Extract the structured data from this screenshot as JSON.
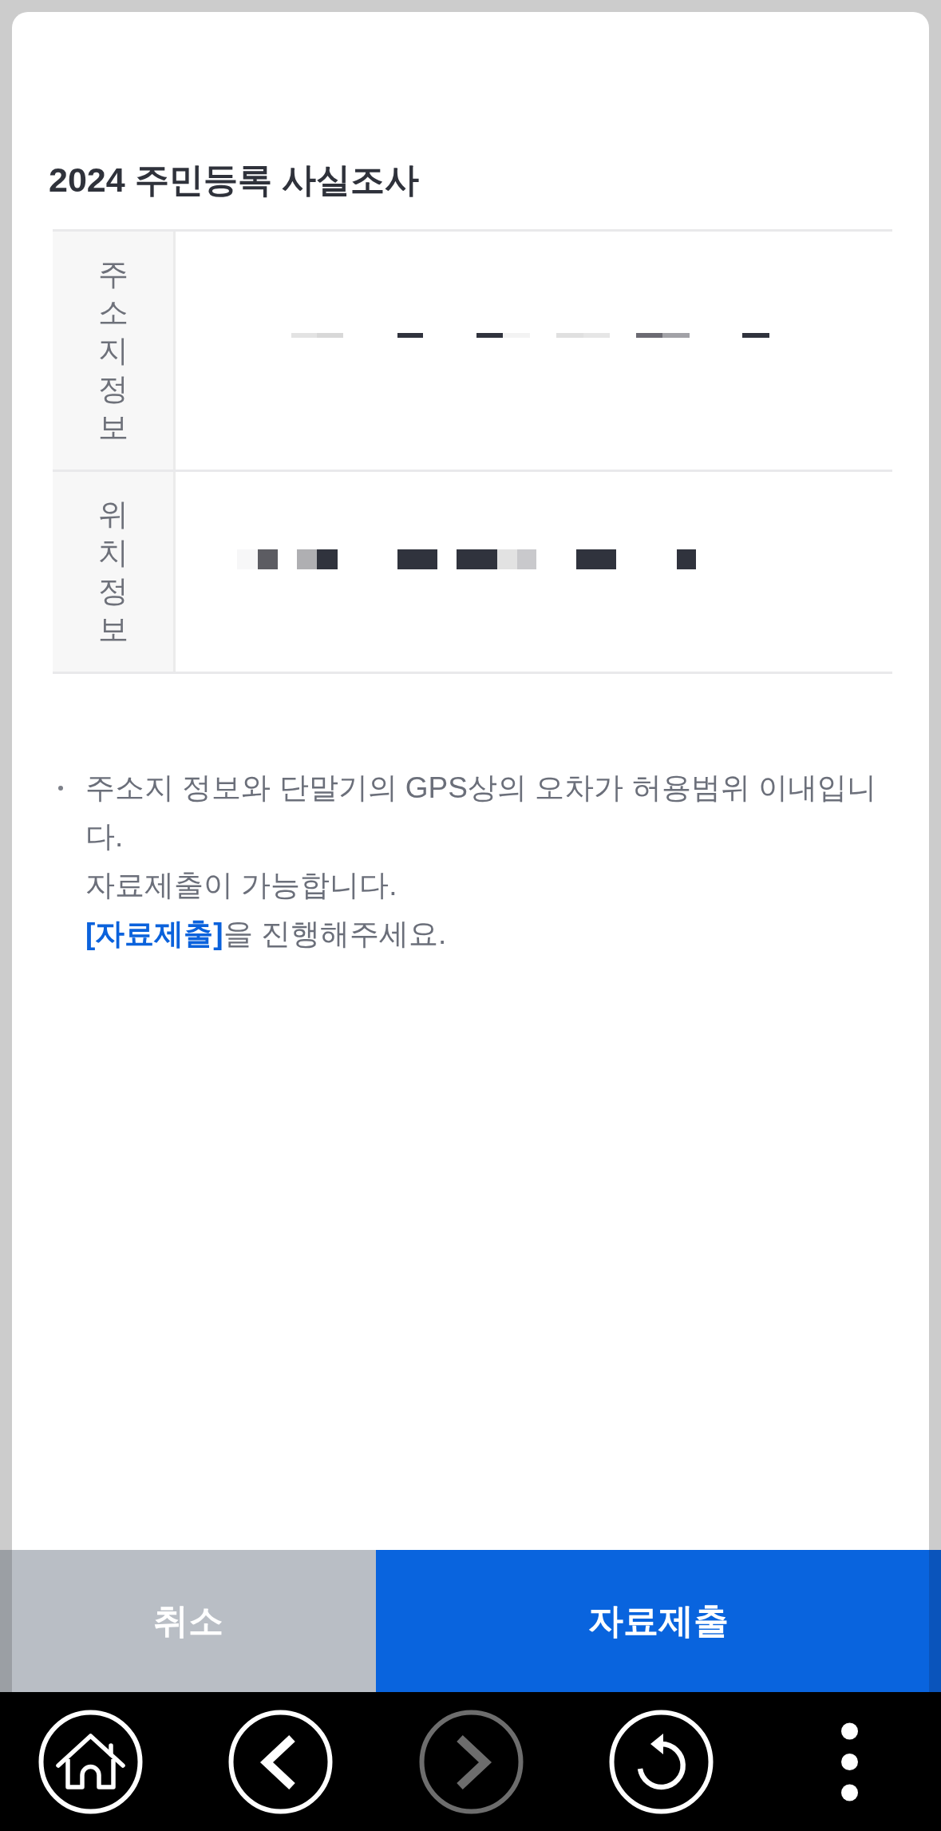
{
  "title": "2024 주민등록 사실조사",
  "info_table": {
    "rows": [
      {
        "label": "주소지정보"
      },
      {
        "label": "위치정보"
      }
    ]
  },
  "notice": {
    "text": "주소지 정보와 단말기의 GPS상의 오차가 허용범위 이내입니다.\n자료제출이 가능합니다.\n**[자료제출]**을 진행해주세요."
  },
  "buttons": [
    {
      "label": "취소",
      "kind": "secondary"
    },
    {
      "label": "자료제출",
      "kind": "primary"
    }
  ],
  "nav_bar": [
    {
      "kind": "home",
      "disabled": false
    },
    {
      "kind": "back",
      "disabled": false
    },
    {
      "kind": "forward",
      "disabled": true
    },
    {
      "kind": "reload",
      "disabled": false
    },
    {
      "kind": "more",
      "disabled": false
    }
  ]
}
